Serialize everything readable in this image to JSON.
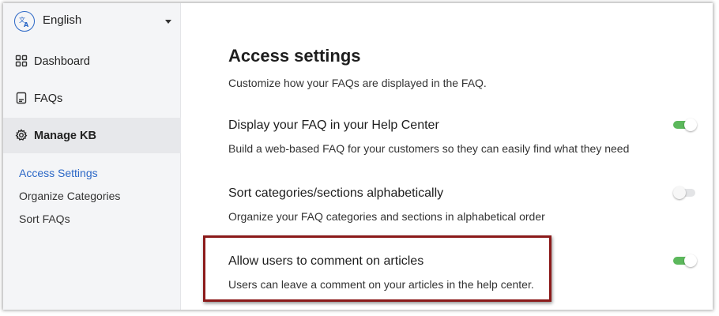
{
  "language": {
    "label": "English",
    "icon": "translate-icon"
  },
  "nav": [
    {
      "label": "Dashboard",
      "icon": "dashboard-grid-icon",
      "active": false
    },
    {
      "label": "FAQs",
      "icon": "faq-document-icon",
      "active": false
    },
    {
      "label": "Manage KB",
      "icon": "gear-icon",
      "active": true
    }
  ],
  "subnav": [
    {
      "label": "Access Settings",
      "active": true
    },
    {
      "label": "Organize Categories",
      "active": false
    },
    {
      "label": "Sort FAQs",
      "active": false
    }
  ],
  "main": {
    "title": "Access settings",
    "description": "Customize how your FAQs are displayed in the FAQ.",
    "settings": [
      {
        "title": "Display your FAQ in your Help Center",
        "description": "Build a web-based FAQ for your customers so they can easily find what they need",
        "enabled": true
      },
      {
        "title": "Sort categories/sections alphabetically",
        "description": "Organize your FAQ categories and sections in alphabetical order",
        "enabled": false
      },
      {
        "title": "Allow users to comment on articles",
        "description": "Users can leave a comment on your articles in the help center.",
        "enabled": true
      }
    ]
  },
  "colors": {
    "accent": "#2b67c6",
    "toggle_on": "#5cb85c",
    "highlight": "#8b1a1a"
  }
}
